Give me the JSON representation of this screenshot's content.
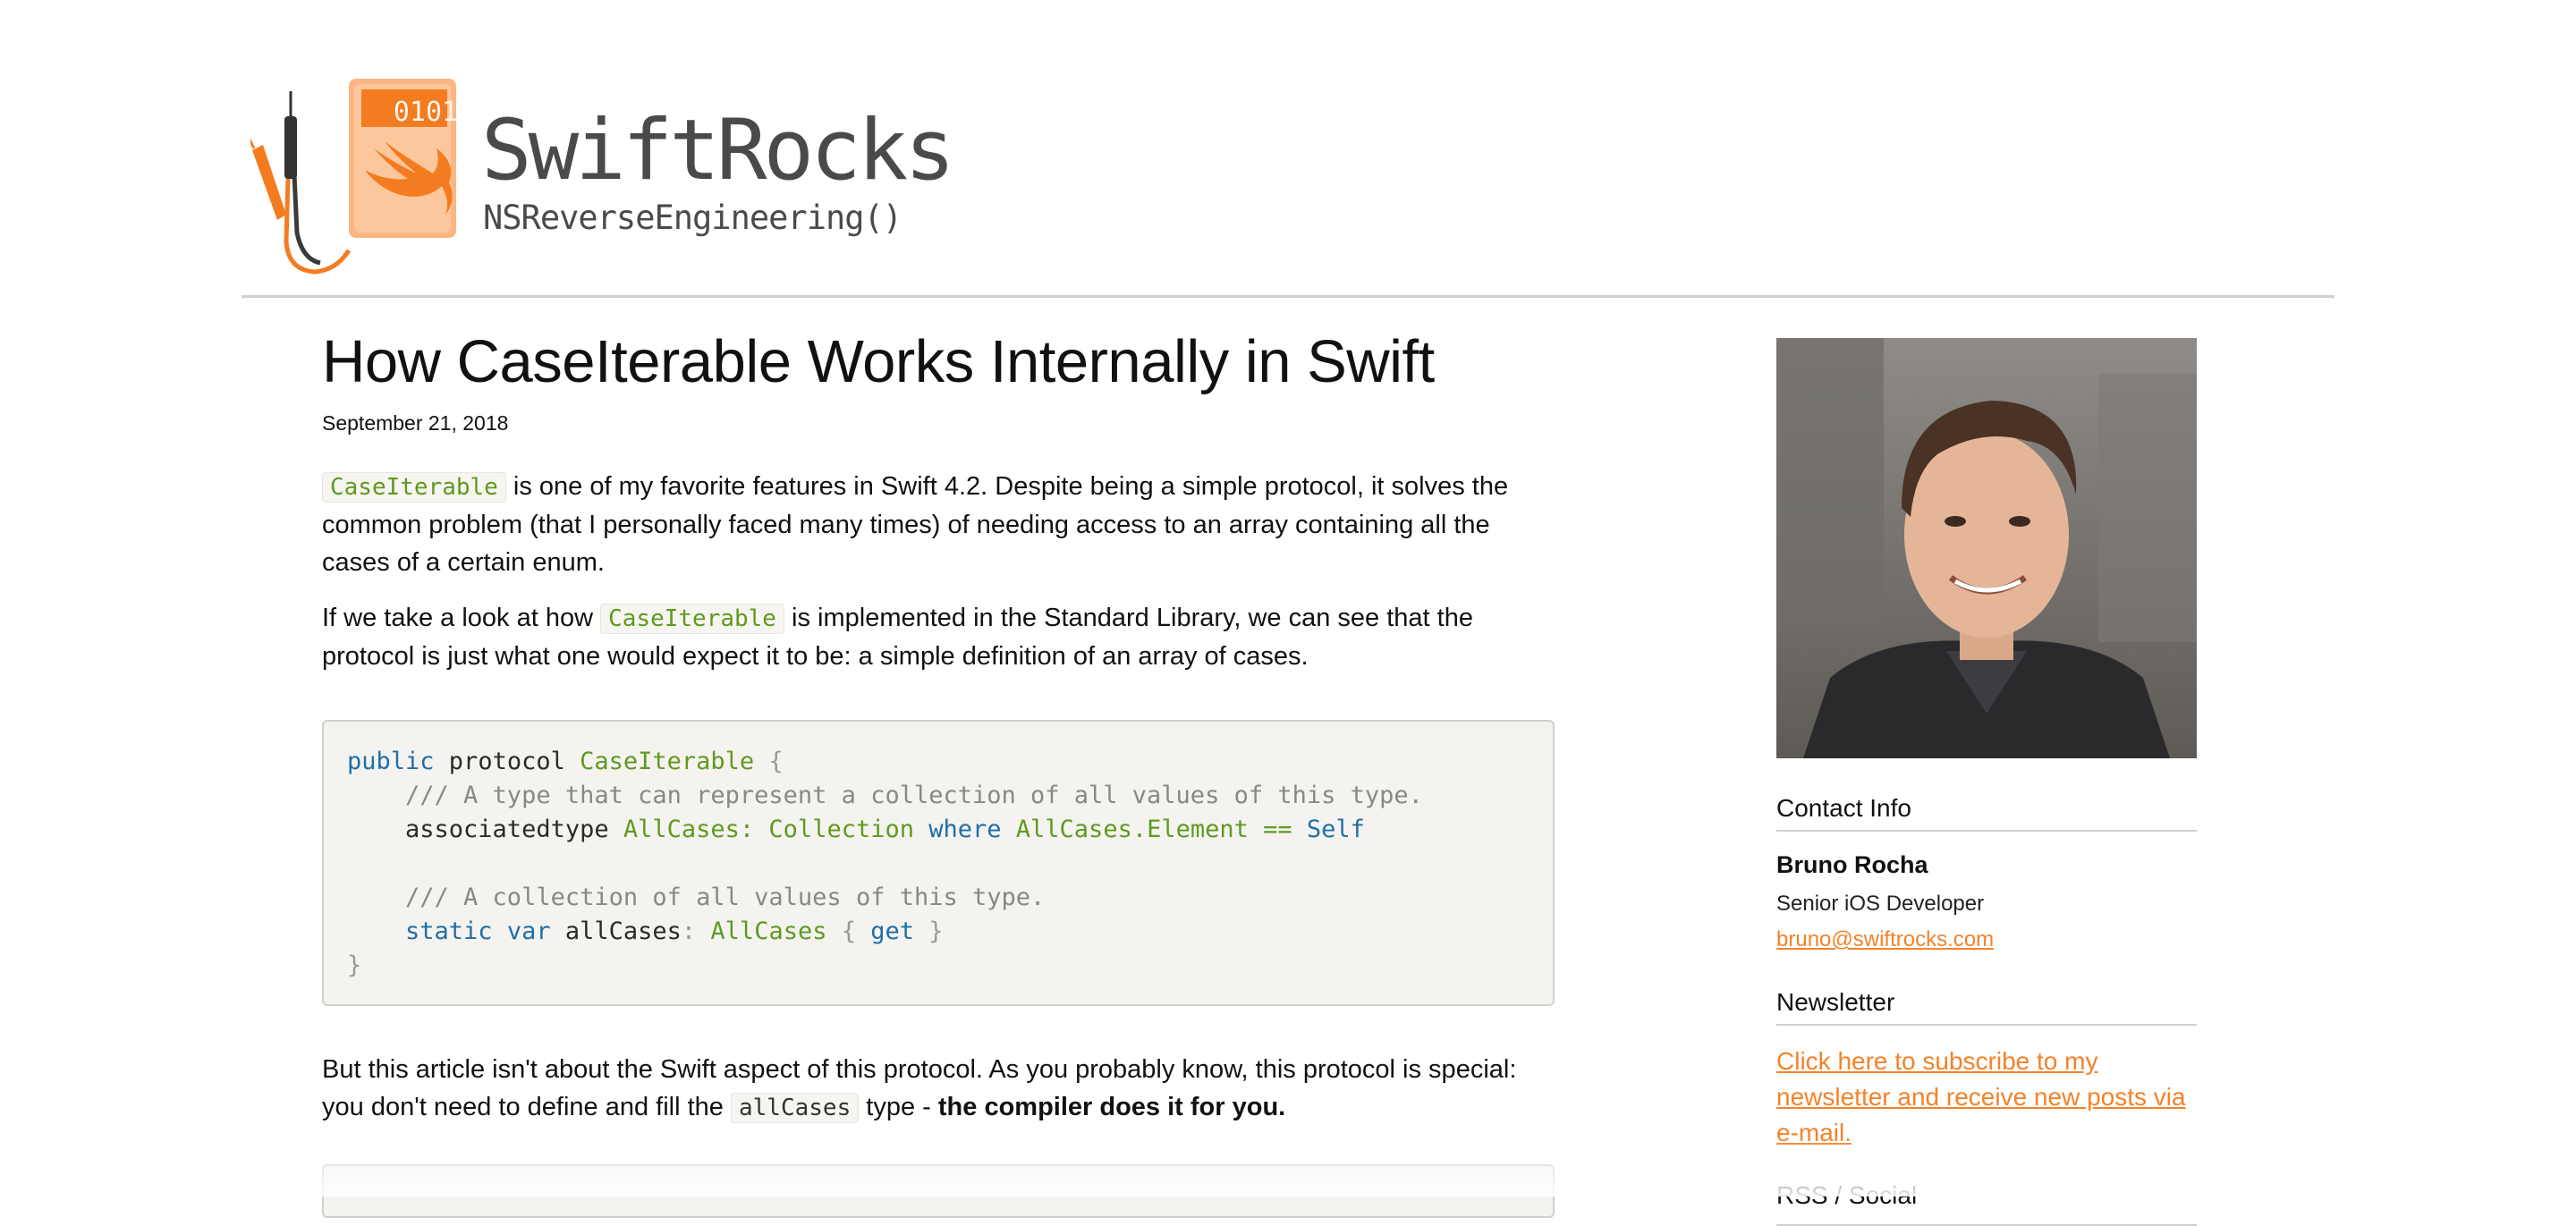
{
  "site": {
    "logo_digits": "0101",
    "logo_title": "SwiftRocks",
    "logo_subtitle": "NSReverseEngineering()",
    "accent_color": "#f4822a"
  },
  "article": {
    "title": "How CaseIterable Works Internally in Swift",
    "date": "September 21, 2018",
    "p1": {
      "code": "CaseIterable",
      "text": " is one of my favorite features in Swift 4.2. Despite being a simple protocol, it solves the common problem (that I personally faced many times) of needing access to an array containing all the cases of a certain enum."
    },
    "p2": {
      "before": "If we take a look at how ",
      "code": "CaseIterable",
      "after": " is implemented in the Standard Library, we can see that the protocol is just what one would expect it to be: a simple definition of an array of cases."
    },
    "code_block": {
      "l1_kw": "public",
      "l1_a": " protocol ",
      "l1_type": "CaseIterable",
      "l1_brace": " {",
      "l2_comment": "    /// A type that can represent a collection of all values of this type.",
      "l3_a": "    associatedtype ",
      "l3_type1": "AllCases",
      "l3_colon": ": ",
      "l3_type2": "Collection",
      "l3_where": " where ",
      "l3_type3": "AllCases.Element",
      "l3_eq": " == ",
      "l3_self": "Self",
      "l5_comment": "    /// A collection of all values of this type.",
      "l6_kw1": "    static",
      "l6_kw2": " var",
      "l6_name": " allCases",
      "l6_colon": ": ",
      "l6_type": "AllCases",
      "l6_open": " { ",
      "l6_get": "get",
      "l6_close": " }",
      "l7_brace": "}"
    },
    "p3": {
      "before": "But this article isn't about the Swift aspect of this protocol. As you probably know, this protocol is special: you don't need to define and fill the ",
      "code": "allCases",
      "middle": " type - ",
      "bold": "the compiler does it for you."
    }
  },
  "sidebar": {
    "contact_heading": "Contact Info",
    "name": "Bruno Rocha",
    "role": "Senior iOS Developer",
    "email": "bruno@swiftrocks.com",
    "newsletter_heading": "Newsletter",
    "newsletter_link": "Click here to subscribe to my newsletter and receive new posts via e-mail.",
    "rss_heading": "RSS / Social"
  }
}
